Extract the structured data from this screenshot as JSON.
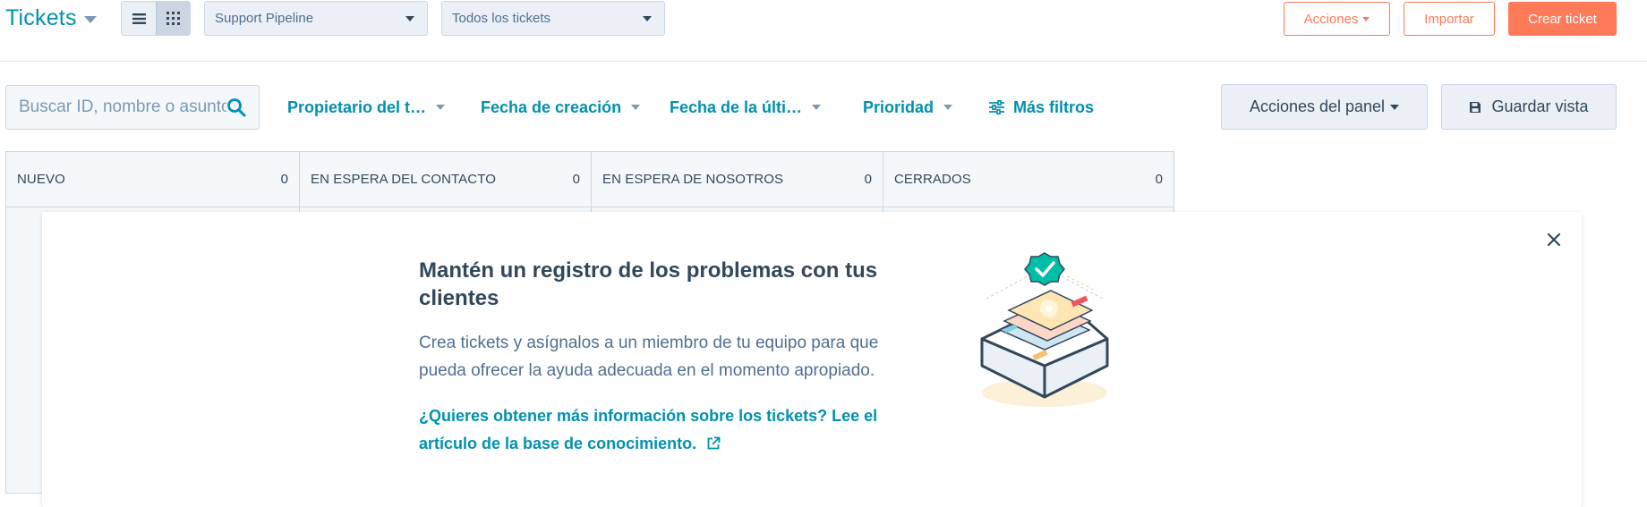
{
  "header": {
    "title": "Tickets",
    "view_toggle": {
      "list_icon": "list-view-icon",
      "board_icon": "board-view-icon",
      "active": "board"
    },
    "pipeline_select": "Support Pipeline",
    "view_select": "Todos los tickets",
    "actions_button": "Acciones",
    "import_button": "Importar",
    "create_button": "Crear ticket"
  },
  "filters": {
    "search_placeholder": "Buscar ID, nombre o asunto",
    "owner": "Propietario del t…",
    "created_date": "Fecha de creación",
    "last_activity": "Fecha de la últi…",
    "priority": "Prioridad",
    "more_filters": "Más filtros",
    "board_actions": "Acciones del panel",
    "save_view": "Guardar vista"
  },
  "board": {
    "columns": [
      {
        "title": "NUEVO",
        "count": "0"
      },
      {
        "title": "EN ESPERA DEL CONTACTO",
        "count": "0"
      },
      {
        "title": "EN ESPERA DE NOSOTROS",
        "count": "0"
      },
      {
        "title": "CERRADOS",
        "count": "0"
      }
    ]
  },
  "onboarding": {
    "heading": "Mantén un registro de los problemas con tus clientes",
    "body": "Crea tickets y asígnalos a un miembro de tu equipo para que pueda ofrecer la ayuda adecuada en el momento apropiado.",
    "link": "¿Quieres obtener más información sobre los tickets? Lee el artículo de la base de conocimiento."
  },
  "colors": {
    "accent": "#0091ae",
    "brand_orange": "#ff7a59",
    "text": "#33475b",
    "muted": "#516f90",
    "panel_bg": "#eaf0f6",
    "border": "#cbd6e2"
  }
}
